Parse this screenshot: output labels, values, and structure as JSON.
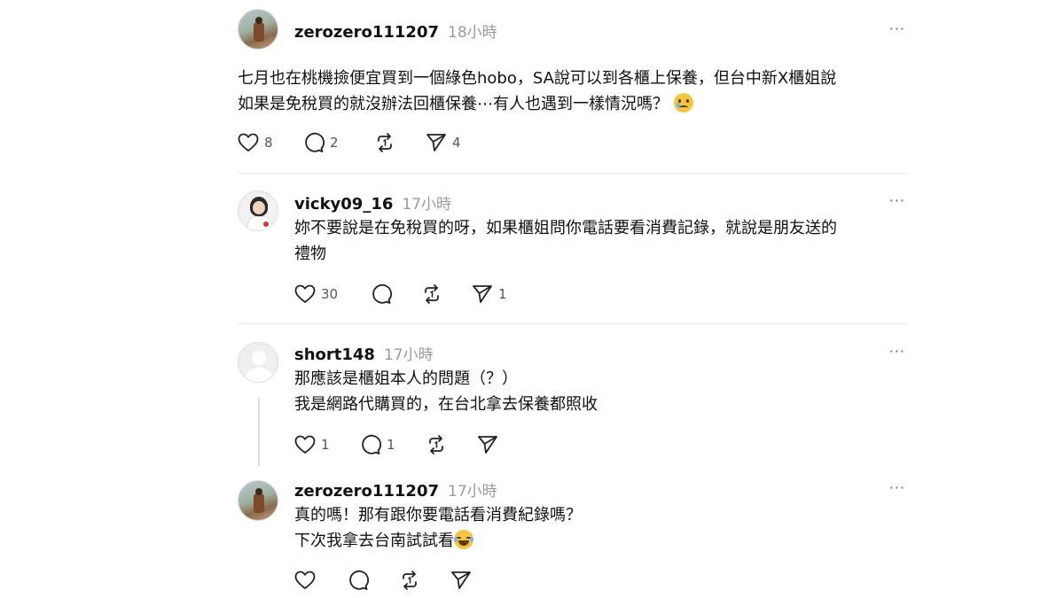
{
  "posts": [
    {
      "username": "zerozero111207",
      "time": "18小時",
      "more": "···",
      "lines": [
        "七月也在桃機撿便宜買到一個綠色hobo，SA說可以到各櫃上保養，但台中新X櫃姐說",
        "如果是免稅買的就沒辦法回櫃保養⋯有人也遇到一樣情況嗎？"
      ],
      "line2_emoji": "face-holding-back-tears",
      "likes": "8",
      "comments": "2",
      "shares": "4"
    },
    {
      "username": "vicky09_16",
      "time": "17小時",
      "more": "···",
      "lines": [
        "妳不要說是在免稅買的呀，如果櫃姐問你電話要看消費記錄，就說是朋友送的",
        "禮物"
      ],
      "likes": "30",
      "comments": "",
      "shares": "1"
    },
    {
      "username": "short148",
      "time": "17小時",
      "more": "···",
      "lines": [
        "那應該是櫃姐本人的問題（？）",
        "我是網路代購買的，在台北拿去保養都照收"
      ],
      "likes": "1",
      "comments": "1",
      "shares": ""
    },
    {
      "username": "zerozero111207",
      "time": "17小時",
      "more": "···",
      "lines": [
        "真的嗎！那有跟你要電話看消費紀錄嗎？",
        "下次我拿去台南試試看"
      ],
      "line2_emoji": "face-with-tears-of-joy",
      "likes": "",
      "comments": "",
      "shares": ""
    }
  ],
  "icons": {
    "like": "heart-icon",
    "comment": "comment-bubble-icon",
    "repost": "repost-icon",
    "share": "send-icon",
    "more": "more-dots-icon"
  },
  "colors": {
    "text": "#111111",
    "muted": "#9a9a9a",
    "divider": "#e6e6e6"
  }
}
